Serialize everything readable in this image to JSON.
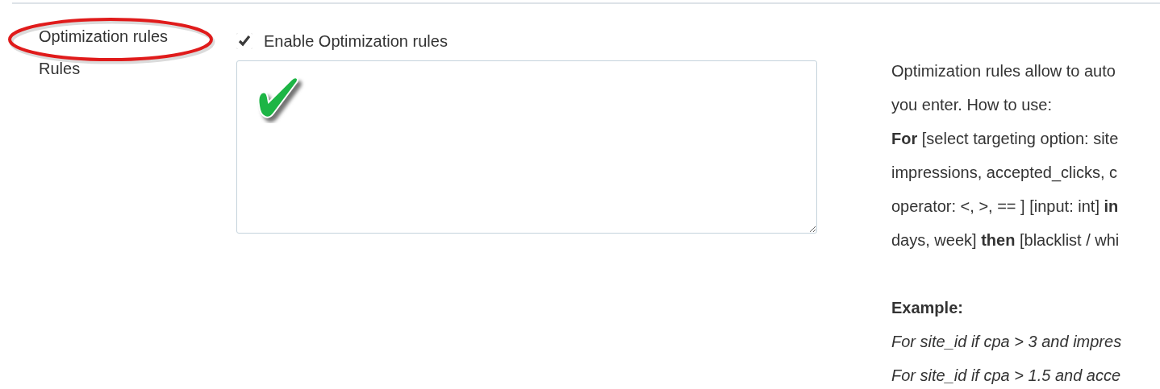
{
  "enable_row": {
    "label": "Optimization rules",
    "circled": true,
    "checkbox": {
      "label": "Enable Optimization rules",
      "checked": true
    }
  },
  "rules_row": {
    "label": "Rules"
  },
  "help": {
    "lines": [
      "Optimization rules allow to auto",
      "you enter. How to use:",
      "**For** [select targeting option: site",
      "impressions, accepted_clicks, c",
      "operator: <, >, == ] [input: int] **in**",
      "days, week] **then** [blacklist / whi"
    ],
    "example_title": "Example:",
    "examples": [
      "For site_id if cpa > 3 and impres",
      "For site_id if cpa > 1.5 and acce"
    ]
  }
}
